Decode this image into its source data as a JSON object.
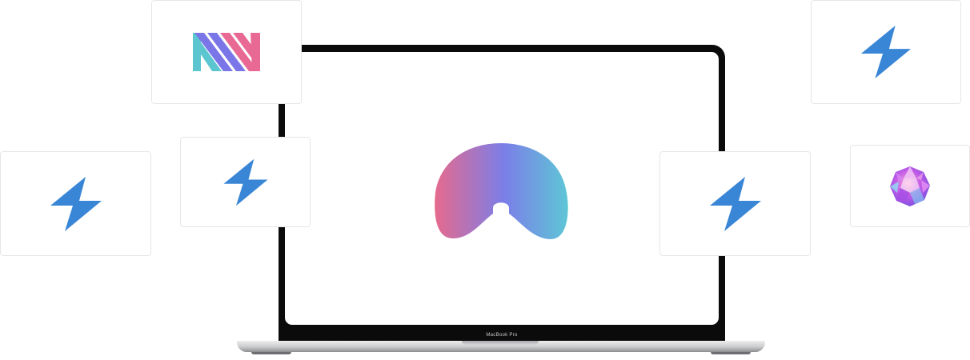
{
  "device": {
    "model_label": "MacBook Pro"
  },
  "screen_logo": {
    "icon": "arch-logo-icon",
    "gradient": [
      "#e66a8d",
      "#7b7ee8",
      "#5ec6d6"
    ]
  },
  "cards": [
    {
      "name": "nn-logo-card",
      "icon": "nn-stripes-logo-icon",
      "colors": [
        "#5cc6d0",
        "#7a76e8",
        "#e86a94"
      ]
    },
    {
      "name": "bolt-card-top-right",
      "icon": "lightning-bolt-icon",
      "color": "#3a86d6"
    },
    {
      "name": "bolt-card-left",
      "icon": "lightning-bolt-icon",
      "color": "#3a86d6"
    },
    {
      "name": "bolt-card-center-left",
      "icon": "lightning-bolt-icon",
      "color": "#3a86d6"
    },
    {
      "name": "bolt-card-center-right",
      "icon": "lightning-bolt-icon",
      "color": "#3a86d6"
    },
    {
      "name": "gem-card",
      "icon": "crystal-gem-icon",
      "colors": [
        "#b44fe8",
        "#ff9fd6",
        "#7fd8f2"
      ]
    }
  ]
}
